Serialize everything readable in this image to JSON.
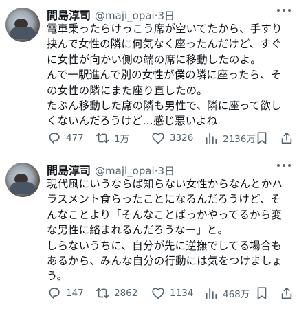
{
  "tweets": [
    {
      "name": "間島淳司",
      "handle": "@maji_opai",
      "time": "3日",
      "lines": [
        "電車乗ったらけっこう席が空いてたから、手すり",
        "挟んで女性の隣に何気なく座ったんだけど、すぐ",
        "に女性が向かい側の端の席に移動したのよ。",
        "んで一駅進んで別の女性が僕の隣に座ったら、そ",
        "の女性の隣にまた座り直したの。",
        "たぶん移動した席の隣も男性で、隣に座って欲し",
        "くないんだろうけど…感じ悪いよね"
      ],
      "replies": "477",
      "retweets": "1万",
      "likes": "3326",
      "views": "2136万"
    },
    {
      "name": "間島淳司",
      "handle": "@maji_opai",
      "time": "3日",
      "lines": [
        "現代風にいうならば知らない女性からなんとかハ",
        "ラスメント食らったことになるんだろうけど、そ",
        "んなことより「そんなことばっかやってるから変",
        "な男性に絡まれるんだろうなー」と。",
        "しらないうちに、自分が先に逆撫でしてる場合も",
        "あるから、みんな自分の行動には気をつけましょ",
        "う。"
      ],
      "replies": "147",
      "retweets": "2862",
      "likes": "1134",
      "views": "468万"
    }
  ],
  "icons": {
    "reply": "reply-icon",
    "retweet": "retweet-icon",
    "like": "heart-icon",
    "views": "views-icon",
    "bookmark": "bookmark-icon",
    "more": "more-icon"
  },
  "colors": {
    "text": "#0f1419",
    "secondary": "#536471",
    "divider": "#eff3f4"
  }
}
